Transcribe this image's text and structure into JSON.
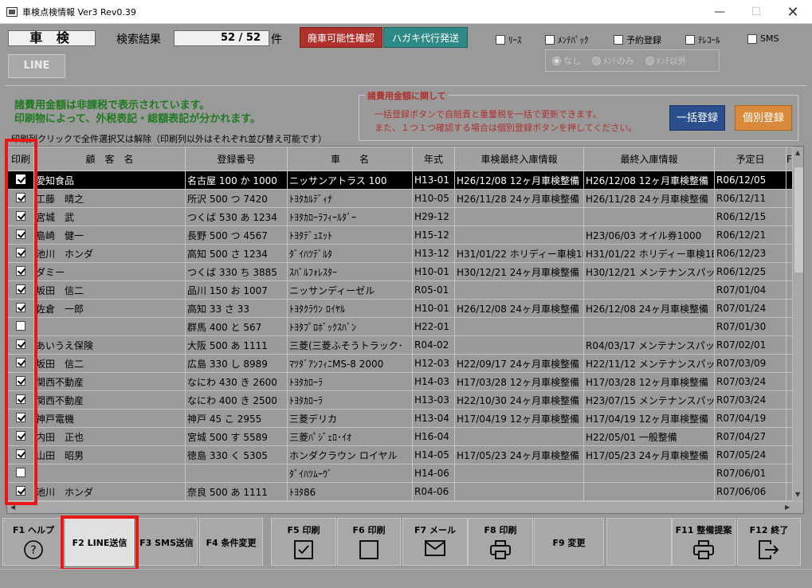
{
  "window": {
    "title": "車検点検情報 Ver3 Rev0.39",
    "minimize": "—",
    "maximize": "☐",
    "close": "✕"
  },
  "top": {
    "mode": "車 検",
    "search_label": "検索結果",
    "result": "52 / 52",
    "result_unit": "件",
    "btn_scrap": "廃車可能性確認",
    "btn_postcard": "ハガキ代行発送",
    "line_button": "LINE",
    "filters": [
      {
        "label": "ﾘｰｽ",
        "checked": false
      },
      {
        "label": "ﾒﾝﾃﾊﾟｯｸ",
        "checked": false
      },
      {
        "label": "予約登録",
        "checked": false
      },
      {
        "label": "ﾃﾚｺｰﾙ",
        "checked": false
      },
      {
        "label": "SMS",
        "checked": false
      }
    ],
    "radios": [
      {
        "label": "なし",
        "selected": true
      },
      {
        "label": "ﾒﾝﾃのみ",
        "selected": false
      },
      {
        "label": "ﾒﾝﾃ以外",
        "selected": false
      }
    ]
  },
  "info": {
    "note1": "諸費用金額は非課税で表示されています。",
    "note2": "印刷物によって、外税表記・総額表記が分かれます。",
    "print_hint": "印刷列クリックで全件選択又は解除（印刷列以外はそれぞれ並び替え可能です）",
    "fee_title": "諸費用金額に関して",
    "fee_line1": "一括登録ボタンで自賠責と重量税を一括で更新できます。",
    "fee_line2": "また、１つ１つ確認する場合は個別登録ボタンを押してください。",
    "btn_bulk": "一括登録",
    "btn_individual": "個別登録"
  },
  "table": {
    "headers": [
      "印刷",
      "顧　客　名",
      "登録番号",
      "車　　名",
      "年式",
      "車検最終入庫情報",
      "最終入庫情報",
      "予定日",
      "F"
    ],
    "rows": [
      {
        "checked": true,
        "customer": "愛知食品",
        "plate": "名古屋 100 か 1000",
        "car": "ニッサンアトラス 100",
        "year": "H13-01",
        "shaken": "H26/12/08 12ヶ月車検整備",
        "last": "H26/12/08 12ヶ月車検整備",
        "date": "R06/12/05"
      },
      {
        "checked": true,
        "customer": "工藤　晴之",
        "plate": "所沢 500 つ 7420",
        "car": "ﾄﾖﾀｶﾙﾃﾞｨﾅ",
        "year": "H10-05",
        "shaken": "H26/11/28 24ヶ月車検整備",
        "last": "H26/11/28 24ヶ月車検整備",
        "date": "R06/12/11"
      },
      {
        "checked": true,
        "customer": "宮城　武",
        "plate": "つくば 530 あ 1234",
        "car": "ﾄﾖﾀｶﾛｰﾗﾌｨｰﾙﾀﾞｰ",
        "year": "H29-12",
        "shaken": "",
        "last": "",
        "date": "R06/12/15"
      },
      {
        "checked": true,
        "customer": "島崎　健一",
        "plate": "長野 500 つ 4567",
        "car": "ﾄﾖﾀﾃﾞｭｴｯﾄ",
        "year": "H15-12",
        "shaken": "",
        "last": "H23/06/03 オイル券1000",
        "date": "R06/12/21"
      },
      {
        "checked": true,
        "customer": "池川　ホンダ",
        "plate": "高知 500 さ 1234",
        "car": "ﾀﾞｲﾊﾂﾃﾞﾙﾀ",
        "year": "H13-12",
        "shaken": "H31/01/22 ホリディー車検1E",
        "last": "H31/01/22 ホリディー車検1E",
        "date": "R06/12/23"
      },
      {
        "checked": true,
        "customer": "ダミー",
        "plate": "つくば 330 ち 3885",
        "car": "ｽﾊﾞﾙﾌｫﾚｽﾀｰ",
        "year": "H10-01",
        "shaken": "H30/12/21 24ヶ月車検整備",
        "last": "H30/12/21 メンテナンスパック",
        "date": "R06/12/25"
      },
      {
        "checked": true,
        "customer": "坂田　信二",
        "plate": "品川 150 お 1007",
        "car": "ニッサンディーゼル",
        "year": "R05-01",
        "shaken": "",
        "last": "",
        "date": "R07/01/04"
      },
      {
        "checked": true,
        "customer": "佐倉　一郎",
        "plate": "高知 33 さ 33",
        "car": "ﾄﾖﾀｸﾗｳﾝ ﾛｲﾔﾙ",
        "year": "H10-01",
        "shaken": "H26/12/08 24ヶ月車検整備",
        "last": "H26/12/08 24ヶ月車検整備",
        "date": "R07/01/24"
      },
      {
        "checked": false,
        "customer": "",
        "plate": "群馬 400 と 567",
        "car": "ﾄﾖﾀﾌﾟﾛﾎﾞｯｸｽﾊﾞﾝ",
        "year": "H22-01",
        "shaken": "",
        "last": "",
        "date": "R07/01/30"
      },
      {
        "checked": true,
        "customer": "あいうえ保険",
        "plate": "大阪 500 あ 1111",
        "car": "三菱(三菱ふそうトラック･",
        "year": "R04-02",
        "shaken": "",
        "last": "R04/03/17 メンテナンスパック",
        "date": "R07/02/01"
      },
      {
        "checked": true,
        "customer": "坂田　信二",
        "plate": "広島 330 し 8989",
        "car": "ﾏﾂﾀﾞｱﾝﾌｨﾆMS-8 2000",
        "year": "H12-03",
        "shaken": "H22/09/17 24ヶ月車検整備",
        "last": "H22/11/12 メンテナンスパック",
        "date": "R07/03/09"
      },
      {
        "checked": true,
        "customer": "関西不動産",
        "plate": "なにわ 430 き 2600",
        "car": "ﾄﾖﾀｶﾛｰﾗ",
        "year": "H14-03",
        "shaken": "H17/03/28 12ヶ月車検整備",
        "last": "H17/03/28 12ヶ月車検整備",
        "date": "R07/03/24"
      },
      {
        "checked": true,
        "customer": "関西不動産",
        "plate": "なにわ 400 き 2500",
        "car": "ﾄﾖﾀｶﾛｰﾗ",
        "year": "H13-03",
        "shaken": "H22/10/30 24ヶ月車検整備",
        "last": "H23/07/15 メンテナンスパック",
        "date": "R07/03/24"
      },
      {
        "checked": true,
        "customer": "神戸電機",
        "plate": "神戸 45 こ 2955",
        "car": "三菱デリカ",
        "year": "H13-04",
        "shaken": "H17/04/19 12ヶ月車検整備",
        "last": "H17/04/19 12ヶ月車検整備",
        "date": "R07/04/19"
      },
      {
        "checked": true,
        "customer": "内田　正也",
        "plate": "宮城 500 す 5589",
        "car": "三菱ﾊﾟｼﾞｪﾛ･ｲｵ",
        "year": "H16-04",
        "shaken": "",
        "last": "H22/05/01 一般整備",
        "date": "R07/04/27"
      },
      {
        "checked": true,
        "customer": "山田　昭男",
        "plate": "徳島 330 く 5305",
        "car": "ホンダクラウン ロイヤル",
        "year": "H14-05",
        "shaken": "H17/05/23 24ヶ月車検整備",
        "last": "H17/05/23 24ヶ月車検整備",
        "date": "R07/05/24"
      },
      {
        "checked": false,
        "customer": "",
        "plate": "",
        "car": "ﾀﾞｲﾊﾂﾑｰｳﾞ",
        "year": "H14-06",
        "shaken": "",
        "last": "",
        "date": "R07/06/01"
      },
      {
        "checked": true,
        "customer": "池川　ホンダ",
        "plate": "奈良 500 あ 1111",
        "car": "ﾄﾖﾀ86",
        "year": "R04-06",
        "shaken": "",
        "last": "",
        "date": "R07/06/06"
      }
    ]
  },
  "fkeys": [
    {
      "label": "F1 ヘルプ",
      "icon": "help-icon"
    },
    {
      "label": "F2 LINE送信",
      "icon": ""
    },
    {
      "label": "F3 SMS送信",
      "icon": ""
    },
    {
      "label": "F4 条件変更",
      "icon": ""
    },
    {
      "label": "F5 印刷",
      "icon": "checkbox-icon"
    },
    {
      "label": "F6 印刷",
      "icon": "square-icon"
    },
    {
      "label": "F7 メール",
      "icon": "mail-icon"
    },
    {
      "label": "F8 印刷",
      "icon": "printer-icon"
    },
    {
      "label": "F9 変更",
      "icon": ""
    },
    {
      "label": "",
      "icon": ""
    },
    {
      "label": "F11 整備提案",
      "icon": "printer-icon"
    },
    {
      "label": "F12 終了",
      "icon": "exit-icon"
    }
  ]
}
